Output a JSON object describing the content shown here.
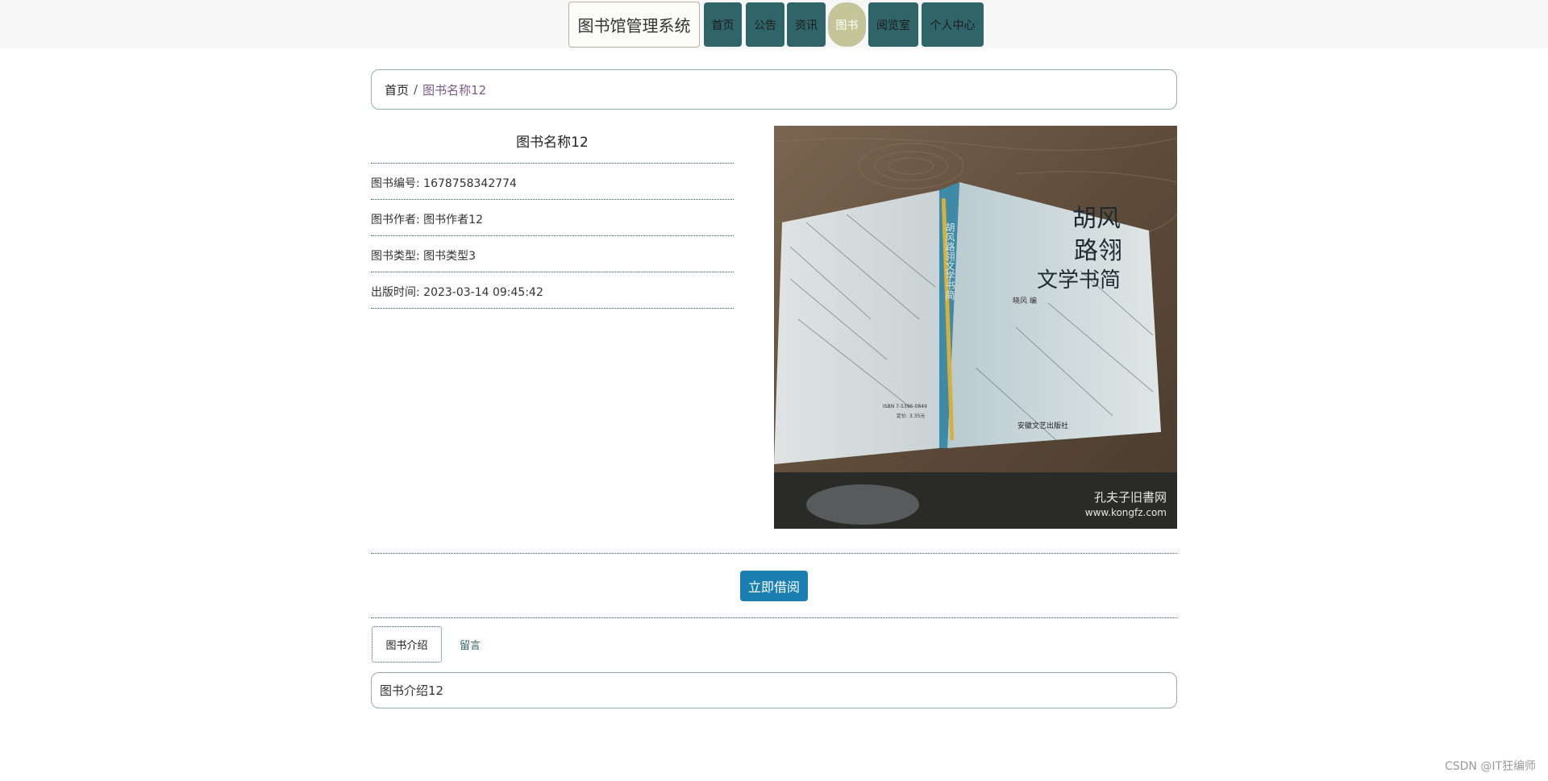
{
  "header": {
    "brand": "图书馆管理系统",
    "nav": [
      {
        "label": "首页",
        "active": false
      },
      {
        "label": "公告",
        "active": false
      },
      {
        "label": "资讯",
        "active": false
      },
      {
        "label": "图书",
        "active": true
      },
      {
        "label": "阅览室",
        "active": false
      },
      {
        "label": "个人中心",
        "active": false
      }
    ]
  },
  "breadcrumb": {
    "home": "首页",
    "separator": "/",
    "current": "图书名称12"
  },
  "book": {
    "title": "图书名称12",
    "fields": [
      {
        "label": "图书编号:",
        "value": "1678758342774"
      },
      {
        "label": "图书作者:",
        "value": "图书作者12"
      },
      {
        "label": "图书类型:",
        "value": "图书类型3"
      },
      {
        "label": "出版时间:",
        "value": "2023-03-14 09:45:42"
      }
    ],
    "cover": {
      "title_line1": "胡风",
      "title_line2": "路翎",
      "title_line3": "文学书简",
      "editor": "晓风  编",
      "publisher": "安徽文艺出版社",
      "spine_text": "胡风路翎文学书简",
      "isbn": "ISBN 7-5396-0849",
      "price": "定价: 3.35元",
      "watermark_cn": "孔夫子旧書网",
      "watermark_url": "www.kongfz.com"
    }
  },
  "actions": {
    "borrow": "立即借阅"
  },
  "tabs": [
    {
      "label": "图书介绍",
      "active": true
    },
    {
      "label": "留言",
      "active": false
    }
  ],
  "intro": "图书介绍12",
  "footer_watermark": "CSDN @IT狂编师",
  "colors": {
    "nav_bg": "#2f6468",
    "nav_active": "#c5c59a",
    "button": "#1a7fb0",
    "border": "#8fb0ad"
  }
}
